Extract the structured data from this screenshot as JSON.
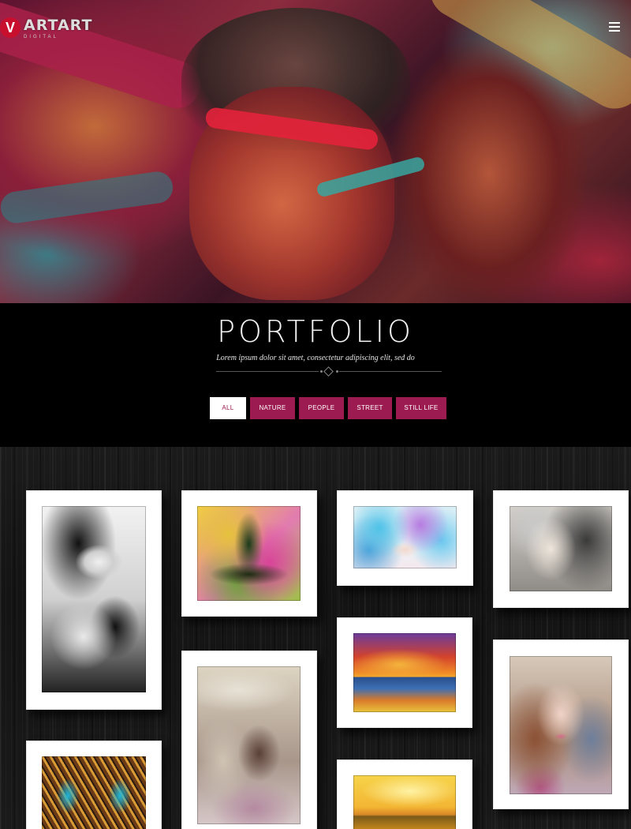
{
  "header": {
    "logo_mark": "V",
    "logo_name": "ARTART",
    "logo_sub": "DIGITAL",
    "menu_icon": "hamburger-menu-icon"
  },
  "portfolio": {
    "title": "PORTFOLIO",
    "subtitle": "Lorem ipsum dolor sit amet, consectetur adipiscing elit, sed do",
    "filters": [
      {
        "label": "ALL",
        "active": true
      },
      {
        "label": "NATURE",
        "active": false
      },
      {
        "label": "PEOPLE",
        "active": false
      },
      {
        "label": "STREET",
        "active": false
      },
      {
        "label": "STILL LIFE",
        "active": false
      }
    ]
  },
  "gallery": {
    "items": [
      {
        "subject": "ink-woman-portrait"
      },
      {
        "subject": "yoga-chakra-figure"
      },
      {
        "subject": "flower-face"
      },
      {
        "subject": "watercolor-face"
      },
      {
        "subject": "native-chief-portrait"
      },
      {
        "subject": "sunset-boat-painting"
      },
      {
        "subject": "colorful-woman-portrait"
      },
      {
        "subject": "stained-glass-pattern"
      },
      {
        "subject": "golden-boat-painting"
      }
    ]
  },
  "colors": {
    "accent": "#9c1b50",
    "background": "#000000",
    "logo_red": "#c8102e"
  }
}
